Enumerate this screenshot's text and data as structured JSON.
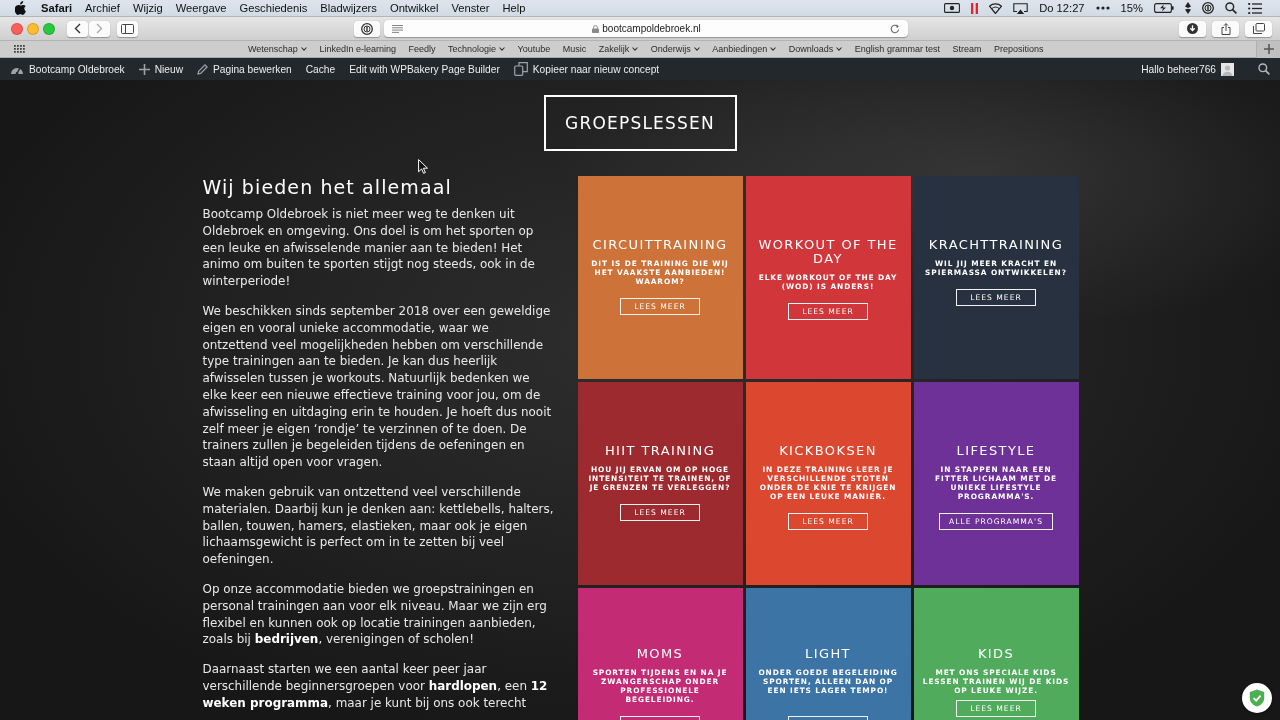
{
  "menu_bar": {
    "app": "Safari",
    "menus": [
      "Archief",
      "Wijzig",
      "Weergave",
      "Geschiedenis",
      "Bladwijzers",
      "Ontwikkel",
      "Venster",
      "Help"
    ],
    "clock": "Do 12:27",
    "battery": "15%"
  },
  "browser": {
    "url": "bootcampoldebroek.nl",
    "bookmarks": [
      {
        "label": "Wetenschap",
        "has_menu": true
      },
      {
        "label": "LinkedIn e-learning",
        "has_menu": false
      },
      {
        "label": "Feedly",
        "has_menu": false
      },
      {
        "label": "Technologie",
        "has_menu": true
      },
      {
        "label": "Youtube",
        "has_menu": false
      },
      {
        "label": "Music",
        "has_menu": false
      },
      {
        "label": "Zakelijk",
        "has_menu": true
      },
      {
        "label": "Onderwijs",
        "has_menu": true
      },
      {
        "label": "Aanbiedingen",
        "has_menu": true
      },
      {
        "label": "Downloads",
        "has_menu": true
      },
      {
        "label": "English grammar test",
        "has_menu": false
      },
      {
        "label": "Stream",
        "has_menu": false
      },
      {
        "label": "Prepositions",
        "has_menu": false
      }
    ]
  },
  "admin_bar": {
    "items": [
      {
        "kind": "dashboard",
        "label": "Bootcamp Oldebroek"
      },
      {
        "kind": "new",
        "label": "Nieuw"
      },
      {
        "kind": "edit",
        "label": "Pagina bewerken"
      },
      {
        "kind": "plain",
        "label": "Cache"
      },
      {
        "kind": "plain",
        "label": "Edit with WPBakery Page Builder"
      },
      {
        "kind": "copy",
        "label": "Kopieer naar nieuw concept"
      }
    ],
    "greeting": "Hallo beheer766"
  },
  "page": {
    "section_title": "GROEPSLESSEN",
    "heading": "Wij bieden het allemaal",
    "paragraphs": [
      "Bootcamp Oldebroek is niet meer weg te denken uit Oldebroek en omgeving. Ons doel is om het sporten op een leuke en afwisselende manier aan te bieden! Het animo om buiten te sporten stijgt nog steeds, ook in de winterperiode!",
      "We beschikken sinds september 2018 over een geweldige eigen en vooral unieke accommodatie, waar we ontzettend veel mogelijkheden hebben om verschillende type trainingen aan te bieden. Je kan dus heerlijk afwisselen tussen je workouts. Natuurlijk bedenken we elke keer een nieuwe effectieve training voor jou, om de afwisseling en uitdaging erin te houden. Je hoeft dus nooit zelf meer je eigen ‘rondje’ te verzinnen of te doen. De trainers zullen je begeleiden tijdens de oefeningen en staan altijd open voor vragen.",
      "We maken gebruik van ontzettend veel verschillende materialen. Daarbij kun je denken aan: kettlebells, halters, ballen, touwen, hamers, elastieken, maar ook je eigen lichaamsgewicht is perfect om in te zetten bij veel oefeningen.",
      "Op onze accommodatie bieden we groepstrainingen en personal trainingen aan voor elk niveau. Maar we zijn erg flexibel en kunnen ook op locatie trainingen aanbieden, zoals bij **bedrijven**, verenigingen of scholen!",
      "Daarnaast starten we een aantal keer peer jaar verschillende beginnersgroepen voor **hardlopen**, een **12 weken programma**, maar je kunt bij ons ook terecht"
    ],
    "classes": [
      {
        "title": "CIRCUITTRAINING",
        "description": "DIT IS DE TRAINING DIE WIJ HET VAAKSTE AANBIEDEN! WAAROM?",
        "color": "#cd7238",
        "button": {
          "label": "LEES MEER",
          "cut_off": false
        }
      },
      {
        "title": "WORKOUT OF THE DAY",
        "description": "ELKE WORKOUT OF THE DAY (WOD) IS ANDERS!",
        "color": "#d1363b",
        "button": {
          "label": "LEES MEER",
          "cut_off": false
        }
      },
      {
        "title": "KRACHTTRAINING",
        "description": "WIL JIJ MEER KRACHT EN SPIERMASSA ONTWIKKELEN?",
        "color": "#27313f",
        "button": {
          "label": "LEES MEER",
          "cut_off": false
        }
      },
      {
        "title": "HIIT TRAINING",
        "description": "HOU JIJ ERVAN OM OP HOGE INTENSITEIT TE TRAINEN, OF JE GRENZEN TE VERLEGGEN?",
        "color": "#9d2a2f",
        "button": {
          "label": "LEES MEER",
          "cut_off": false
        }
      },
      {
        "title": "KICKBOKSEN",
        "description": "IN DEZE TRAINING LEER JE VERSCHILLENDE STOTEN ONDER DE KNIE TE KRIJGEN OP EEN LEUKE MANIER.",
        "color": "#dc4730",
        "button": {
          "label": "LEES MEER",
          "cut_off": false
        }
      },
      {
        "title": "LIFESTYLE",
        "description": "IN STAPPEN NAAR EEN FITTER LICHAAM MET DE UNIEKE LIFESTYLE PROGRAMMA'S.",
        "color": "#6e3198",
        "button": {
          "label": "ALLE PROGRAMMA'S",
          "cut_off": false
        }
      },
      {
        "title": "MOMS",
        "description": "SPORTEN TIJDENS EN NA JE ZWANGERSCHAP ONDER PROFESSIONELE BEGELEIDING.",
        "color": "#c42b75",
        "button": {
          "cut_off": true
        }
      },
      {
        "title": "LIGHT",
        "description": "ONDER GOEDE BEGELEIDING SPORTEN, ALLEEN DAN OP EEN IETS LAGER TEMPO!",
        "color": "#3c75a5",
        "button": {
          "cut_off": true
        }
      },
      {
        "title": "KIDS",
        "description": "MET ONS SPECIALE KIDS LESSEN TRAINEN WIJ DE KIDS OP LEUKE WIJZE.",
        "color": "#50ac5c",
        "button": {
          "label": "LEES MEER",
          "cut_off": false
        }
      }
    ]
  }
}
